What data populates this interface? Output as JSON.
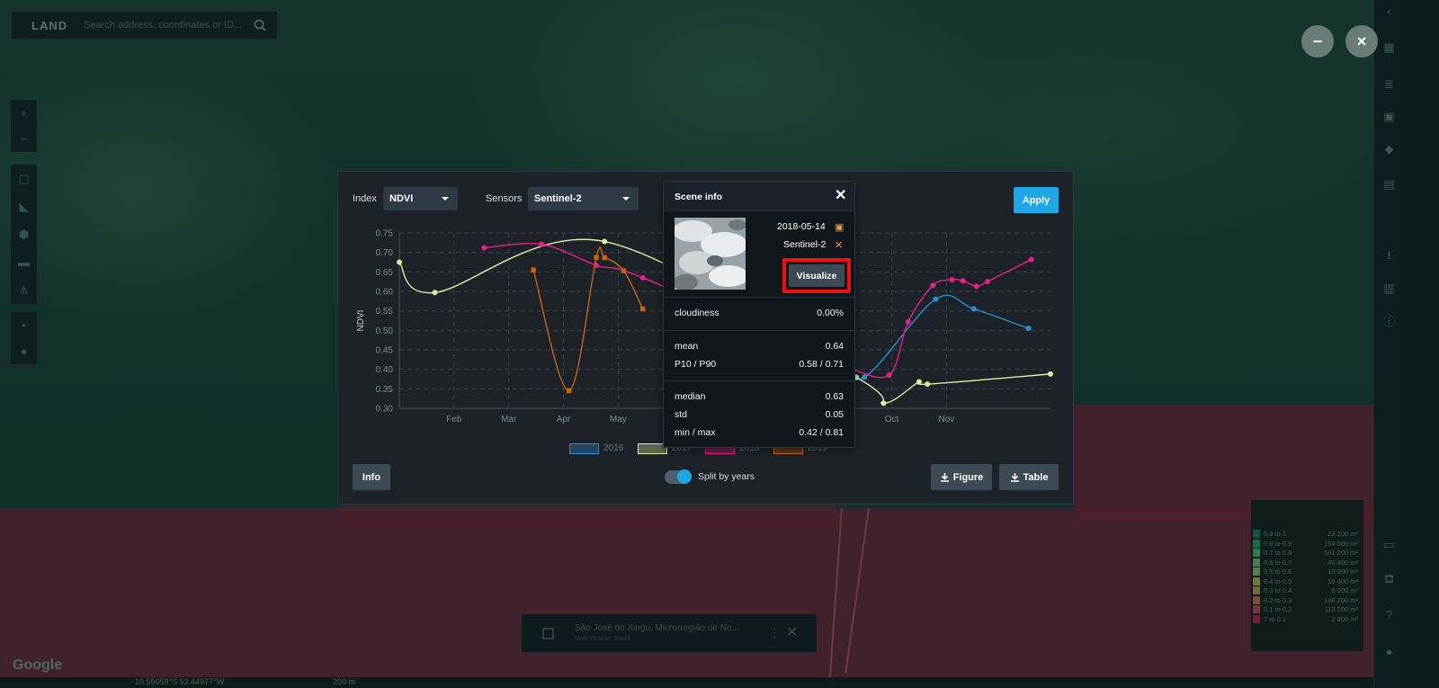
{
  "app": {
    "logo": "LAND",
    "search_placeholder": "Search address, coordinates or ID..."
  },
  "window_controls": {
    "minimize": "−",
    "close": "×"
  },
  "controls": {
    "index_label": "Index",
    "index_value": "NDVI",
    "sensors_label": "Sensors",
    "sensors_value": "Sentinel-2",
    "apply": "Apply",
    "info": "Info",
    "split_label": "Split by years",
    "split_on": true,
    "figure": "Figure",
    "table": "Table"
  },
  "scene_info": {
    "title": "Scene info",
    "close": "✕",
    "date": "2018-05-14",
    "sensor": "Sentinel-2",
    "visualize": "Visualize",
    "stats": [
      {
        "label": "cloudiness",
        "value": "0.00%"
      },
      {
        "label": "mean",
        "value": "0.64"
      },
      {
        "label": "P10 / P90",
        "value": "0.58 / 0.71"
      },
      {
        "label": "median",
        "value": "0.63"
      },
      {
        "label": "std",
        "value": "0.05"
      },
      {
        "label": "min / max",
        "value": "0.42 / 0.81"
      }
    ]
  },
  "colors": {
    "accent": "#1ea7e4",
    "series_2016": "#2a8fd0",
    "series_2017": "#d9ef9b",
    "series_2018": "#e8208a",
    "series_2019": "#c8650e",
    "highlight_border": "#ee1111"
  },
  "chart_data": {
    "type": "line",
    "ylabel": "NDVI",
    "ylim": [
      0.3,
      0.75
    ],
    "yticks": [
      "0.75",
      "0.70",
      "0.65",
      "0.60",
      "0.55",
      "0.50",
      "0.45",
      "0.40",
      "0.35",
      "0.30"
    ],
    "xlim": [
      1,
      12.9
    ],
    "xticks": [
      {
        "label": "Feb",
        "x": 2
      },
      {
        "label": "Mar",
        "x": 3
      },
      {
        "label": "Apr",
        "x": 4
      },
      {
        "label": "May",
        "x": 5
      },
      {
        "label": "Sep",
        "x": 9
      },
      {
        "label": "Oct",
        "x": 10
      },
      {
        "label": "Nov",
        "x": 11
      }
    ],
    "grid": true,
    "legend_position": "bottom-center",
    "series": [
      {
        "name": "2016",
        "x": [
          8.85,
          9.5,
          10.8,
          11.5,
          12.5
        ],
        "y": [
          0.42,
          0.38,
          0.58,
          0.555,
          0.505
        ]
      },
      {
        "name": "2017",
        "x": [
          1,
          1.65,
          4.75,
          9.35,
          9.85,
          10.5,
          10.65,
          12.9
        ],
        "y": [
          0.675,
          0.597,
          0.728,
          0.38,
          0.313,
          0.368,
          0.362,
          0.388
        ]
      },
      {
        "name": "2018",
        "x": [
          2.55,
          3.6,
          4.6,
          5.45,
          8.85,
          9.2,
          9.95,
          10.3,
          10.75,
          11.1,
          11.3,
          11.55,
          11.75,
          12.55
        ],
        "y": [
          0.712,
          0.721,
          0.667,
          0.635,
          0.425,
          0.405,
          0.385,
          0.522,
          0.615,
          0.63,
          0.627,
          0.613,
          0.625,
          0.682
        ]
      },
      {
        "name": "2019",
        "x": [
          3.45,
          4.1,
          4.6,
          4.75,
          5.1,
          5.45
        ],
        "y": [
          0.655,
          0.345,
          0.687,
          0.687,
          0.653,
          0.555
        ]
      }
    ]
  },
  "legend_panel": {
    "rows": [
      {
        "range": "0.9 to 1",
        "area": "23 200 m²",
        "color": "#11574a"
      },
      {
        "range": "0.8 to 0.9",
        "area": "154 000 m²",
        "color": "#1c6a4d"
      },
      {
        "range": "0.7 to 0.8",
        "area": "581 200 m²",
        "color": "#2f7a4e"
      },
      {
        "range": "0.6 to 0.7",
        "area": "40 400 m²",
        "color": "#457e4c"
      },
      {
        "range": "0.5 to 0.6",
        "area": "10 000 m²",
        "color": "#5a7c49"
      },
      {
        "range": "0.4 to 0.5",
        "area": "10 400 m²",
        "color": "#6f7445"
      },
      {
        "range": "0.3 to 0.4",
        "area": "8 000 m²",
        "color": "#7a6440"
      },
      {
        "range": "0.2 to 0.3",
        "area": "148 200 m²",
        "color": "#7e4c3c"
      },
      {
        "range": "0.1 to 0.2",
        "area": "113 200 m²",
        "color": "#7c3439"
      },
      {
        "range": "? to 0.1",
        "area": "2 800 m²",
        "color": "#741f37"
      }
    ]
  },
  "location": {
    "name": "São José do Xingu, Microrregião de No...",
    "subtitle": "Mato Grosso, Brazil"
  },
  "map": {
    "attribution": "Google",
    "scale": "200 m",
    "coords": "10.55059°S 52.44977°W"
  }
}
